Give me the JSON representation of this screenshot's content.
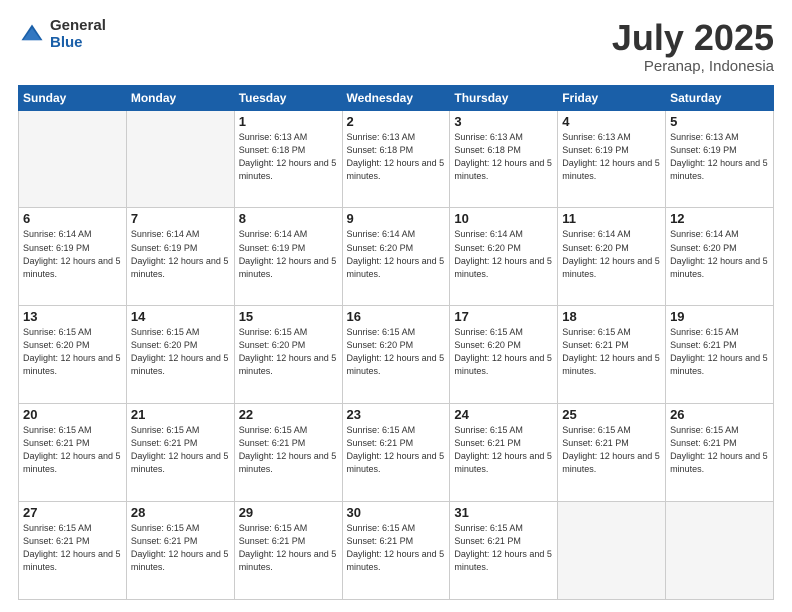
{
  "header": {
    "logo_general": "General",
    "logo_blue": "Blue",
    "month": "July 2025",
    "location": "Peranap, Indonesia"
  },
  "weekdays": [
    "Sunday",
    "Monday",
    "Tuesday",
    "Wednesday",
    "Thursday",
    "Friday",
    "Saturday"
  ],
  "weeks": [
    [
      {
        "day": null,
        "sunrise": null,
        "sunset": null,
        "daylight": null
      },
      {
        "day": null,
        "sunrise": null,
        "sunset": null,
        "daylight": null
      },
      {
        "day": "1",
        "sunrise": "Sunrise: 6:13 AM",
        "sunset": "Sunset: 6:18 PM",
        "daylight": "Daylight: 12 hours and 5 minutes."
      },
      {
        "day": "2",
        "sunrise": "Sunrise: 6:13 AM",
        "sunset": "Sunset: 6:18 PM",
        "daylight": "Daylight: 12 hours and 5 minutes."
      },
      {
        "day": "3",
        "sunrise": "Sunrise: 6:13 AM",
        "sunset": "Sunset: 6:18 PM",
        "daylight": "Daylight: 12 hours and 5 minutes."
      },
      {
        "day": "4",
        "sunrise": "Sunrise: 6:13 AM",
        "sunset": "Sunset: 6:19 PM",
        "daylight": "Daylight: 12 hours and 5 minutes."
      },
      {
        "day": "5",
        "sunrise": "Sunrise: 6:13 AM",
        "sunset": "Sunset: 6:19 PM",
        "daylight": "Daylight: 12 hours and 5 minutes."
      }
    ],
    [
      {
        "day": "6",
        "sunrise": "Sunrise: 6:14 AM",
        "sunset": "Sunset: 6:19 PM",
        "daylight": "Daylight: 12 hours and 5 minutes."
      },
      {
        "day": "7",
        "sunrise": "Sunrise: 6:14 AM",
        "sunset": "Sunset: 6:19 PM",
        "daylight": "Daylight: 12 hours and 5 minutes."
      },
      {
        "day": "8",
        "sunrise": "Sunrise: 6:14 AM",
        "sunset": "Sunset: 6:19 PM",
        "daylight": "Daylight: 12 hours and 5 minutes."
      },
      {
        "day": "9",
        "sunrise": "Sunrise: 6:14 AM",
        "sunset": "Sunset: 6:20 PM",
        "daylight": "Daylight: 12 hours and 5 minutes."
      },
      {
        "day": "10",
        "sunrise": "Sunrise: 6:14 AM",
        "sunset": "Sunset: 6:20 PM",
        "daylight": "Daylight: 12 hours and 5 minutes."
      },
      {
        "day": "11",
        "sunrise": "Sunrise: 6:14 AM",
        "sunset": "Sunset: 6:20 PM",
        "daylight": "Daylight: 12 hours and 5 minutes."
      },
      {
        "day": "12",
        "sunrise": "Sunrise: 6:14 AM",
        "sunset": "Sunset: 6:20 PM",
        "daylight": "Daylight: 12 hours and 5 minutes."
      }
    ],
    [
      {
        "day": "13",
        "sunrise": "Sunrise: 6:15 AM",
        "sunset": "Sunset: 6:20 PM",
        "daylight": "Daylight: 12 hours and 5 minutes."
      },
      {
        "day": "14",
        "sunrise": "Sunrise: 6:15 AM",
        "sunset": "Sunset: 6:20 PM",
        "daylight": "Daylight: 12 hours and 5 minutes."
      },
      {
        "day": "15",
        "sunrise": "Sunrise: 6:15 AM",
        "sunset": "Sunset: 6:20 PM",
        "daylight": "Daylight: 12 hours and 5 minutes."
      },
      {
        "day": "16",
        "sunrise": "Sunrise: 6:15 AM",
        "sunset": "Sunset: 6:20 PM",
        "daylight": "Daylight: 12 hours and 5 minutes."
      },
      {
        "day": "17",
        "sunrise": "Sunrise: 6:15 AM",
        "sunset": "Sunset: 6:20 PM",
        "daylight": "Daylight: 12 hours and 5 minutes."
      },
      {
        "day": "18",
        "sunrise": "Sunrise: 6:15 AM",
        "sunset": "Sunset: 6:21 PM",
        "daylight": "Daylight: 12 hours and 5 minutes."
      },
      {
        "day": "19",
        "sunrise": "Sunrise: 6:15 AM",
        "sunset": "Sunset: 6:21 PM",
        "daylight": "Daylight: 12 hours and 5 minutes."
      }
    ],
    [
      {
        "day": "20",
        "sunrise": "Sunrise: 6:15 AM",
        "sunset": "Sunset: 6:21 PM",
        "daylight": "Daylight: 12 hours and 5 minutes."
      },
      {
        "day": "21",
        "sunrise": "Sunrise: 6:15 AM",
        "sunset": "Sunset: 6:21 PM",
        "daylight": "Daylight: 12 hours and 5 minutes."
      },
      {
        "day": "22",
        "sunrise": "Sunrise: 6:15 AM",
        "sunset": "Sunset: 6:21 PM",
        "daylight": "Daylight: 12 hours and 5 minutes."
      },
      {
        "day": "23",
        "sunrise": "Sunrise: 6:15 AM",
        "sunset": "Sunset: 6:21 PM",
        "daylight": "Daylight: 12 hours and 5 minutes."
      },
      {
        "day": "24",
        "sunrise": "Sunrise: 6:15 AM",
        "sunset": "Sunset: 6:21 PM",
        "daylight": "Daylight: 12 hours and 5 minutes."
      },
      {
        "day": "25",
        "sunrise": "Sunrise: 6:15 AM",
        "sunset": "Sunset: 6:21 PM",
        "daylight": "Daylight: 12 hours and 5 minutes."
      },
      {
        "day": "26",
        "sunrise": "Sunrise: 6:15 AM",
        "sunset": "Sunset: 6:21 PM",
        "daylight": "Daylight: 12 hours and 5 minutes."
      }
    ],
    [
      {
        "day": "27",
        "sunrise": "Sunrise: 6:15 AM",
        "sunset": "Sunset: 6:21 PM",
        "daylight": "Daylight: 12 hours and 5 minutes."
      },
      {
        "day": "28",
        "sunrise": "Sunrise: 6:15 AM",
        "sunset": "Sunset: 6:21 PM",
        "daylight": "Daylight: 12 hours and 5 minutes."
      },
      {
        "day": "29",
        "sunrise": "Sunrise: 6:15 AM",
        "sunset": "Sunset: 6:21 PM",
        "daylight": "Daylight: 12 hours and 5 minutes."
      },
      {
        "day": "30",
        "sunrise": "Sunrise: 6:15 AM",
        "sunset": "Sunset: 6:21 PM",
        "daylight": "Daylight: 12 hours and 5 minutes."
      },
      {
        "day": "31",
        "sunrise": "Sunrise: 6:15 AM",
        "sunset": "Sunset: 6:21 PM",
        "daylight": "Daylight: 12 hours and 5 minutes."
      },
      {
        "day": null,
        "sunrise": null,
        "sunset": null,
        "daylight": null
      },
      {
        "day": null,
        "sunrise": null,
        "sunset": null,
        "daylight": null
      }
    ]
  ]
}
